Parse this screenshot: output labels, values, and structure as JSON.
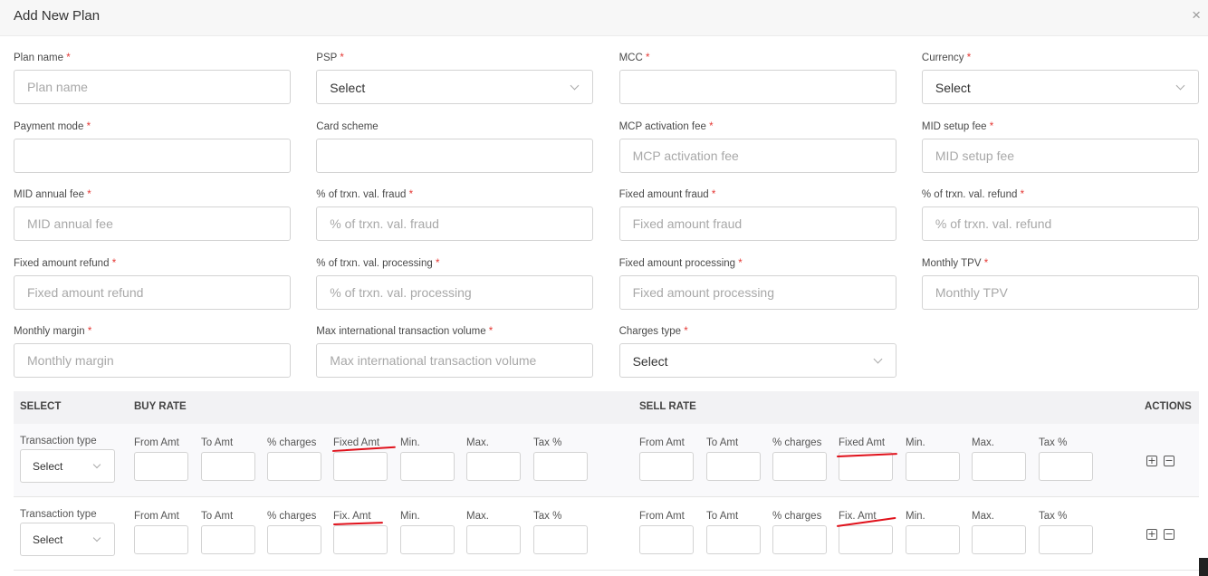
{
  "modal": {
    "title": "Add New Plan",
    "close_glyph": "×"
  },
  "form": {
    "required_mark": "*",
    "fields": [
      {
        "label": "Plan name",
        "required": true,
        "type": "input",
        "placeholder": "Plan name",
        "value": ""
      },
      {
        "label": "PSP",
        "required": true,
        "type": "select",
        "value": "Select"
      },
      {
        "label": "MCC",
        "required": true,
        "type": "input",
        "placeholder": "",
        "value": ""
      },
      {
        "label": "Currency",
        "required": true,
        "type": "select",
        "value": "Select"
      },
      {
        "label": "Payment mode",
        "required": true,
        "type": "input",
        "placeholder": "",
        "value": ""
      },
      {
        "label": "Card scheme",
        "required": false,
        "type": "input",
        "placeholder": "",
        "value": ""
      },
      {
        "label": "MCP activation fee",
        "required": true,
        "type": "input",
        "placeholder": "MCP activation fee",
        "value": ""
      },
      {
        "label": "MID setup fee",
        "required": true,
        "type": "input",
        "placeholder": "MID setup fee",
        "value": ""
      },
      {
        "label": "MID annual fee",
        "required": true,
        "type": "input",
        "placeholder": "MID annual fee",
        "value": ""
      },
      {
        "label": "% of trxn. val. fraud",
        "required": true,
        "type": "input",
        "placeholder": "% of trxn. val. fraud",
        "value": ""
      },
      {
        "label": "Fixed amount fraud",
        "required": true,
        "type": "input",
        "placeholder": "Fixed amount fraud",
        "value": ""
      },
      {
        "label": "% of trxn. val. refund",
        "required": true,
        "type": "input",
        "placeholder": "% of trxn. val. refund",
        "value": ""
      },
      {
        "label": "Fixed amount refund",
        "required": true,
        "type": "input",
        "placeholder": "Fixed amount refund",
        "value": ""
      },
      {
        "label": "% of trxn. val. processing",
        "required": true,
        "type": "input",
        "placeholder": "% of trxn. val. processing",
        "value": ""
      },
      {
        "label": "Fixed amount processing",
        "required": true,
        "type": "input",
        "placeholder": "Fixed amount processing",
        "value": ""
      },
      {
        "label": "Monthly TPV",
        "required": true,
        "type": "input",
        "placeholder": "Monthly TPV",
        "value": ""
      },
      {
        "label": "Monthly margin",
        "required": true,
        "type": "input",
        "placeholder": "Monthly margin",
        "value": ""
      },
      {
        "label": "Max international transaction volume",
        "required": true,
        "type": "input",
        "placeholder": "Max international transaction volume",
        "value": ""
      },
      {
        "label": "Charges type",
        "required": true,
        "type": "select",
        "value": "Select"
      }
    ]
  },
  "rates": {
    "headers": {
      "select": "SELECT",
      "buy": "BUY RATE",
      "sell": "SELL RATE",
      "actions": "ACTIONS"
    },
    "rows": [
      {
        "type_label": "Transaction type",
        "type_value": "Select",
        "buy_labels": [
          "From Amt",
          "To Amt",
          "% charges",
          "Fixed Amt",
          "Min.",
          "Max.",
          "Tax %"
        ],
        "sell_labels": [
          "From Amt",
          "To Amt",
          "% charges",
          "Fixed Amt",
          "Min.",
          "Max.",
          "Tax %"
        ]
      },
      {
        "type_label": "Transaction type",
        "type_value": "Select",
        "buy_labels": [
          "From Amt",
          "To Amt",
          "% charges",
          "Fix. Amt",
          "Min.",
          "Max.",
          "Tax %"
        ],
        "sell_labels": [
          "From Amt",
          "To Amt",
          "% charges",
          "Fix. Amt",
          "Min.",
          "Max.",
          "Tax %"
        ]
      }
    ],
    "action_icons": [
      {
        "name": "add-icon",
        "glyph": "+"
      },
      {
        "name": "remove-icon",
        "glyph": "−"
      }
    ]
  },
  "colors": {
    "required": "#e53935",
    "annotation": "#e0111b",
    "header_bg": "#f2f2f4"
  }
}
